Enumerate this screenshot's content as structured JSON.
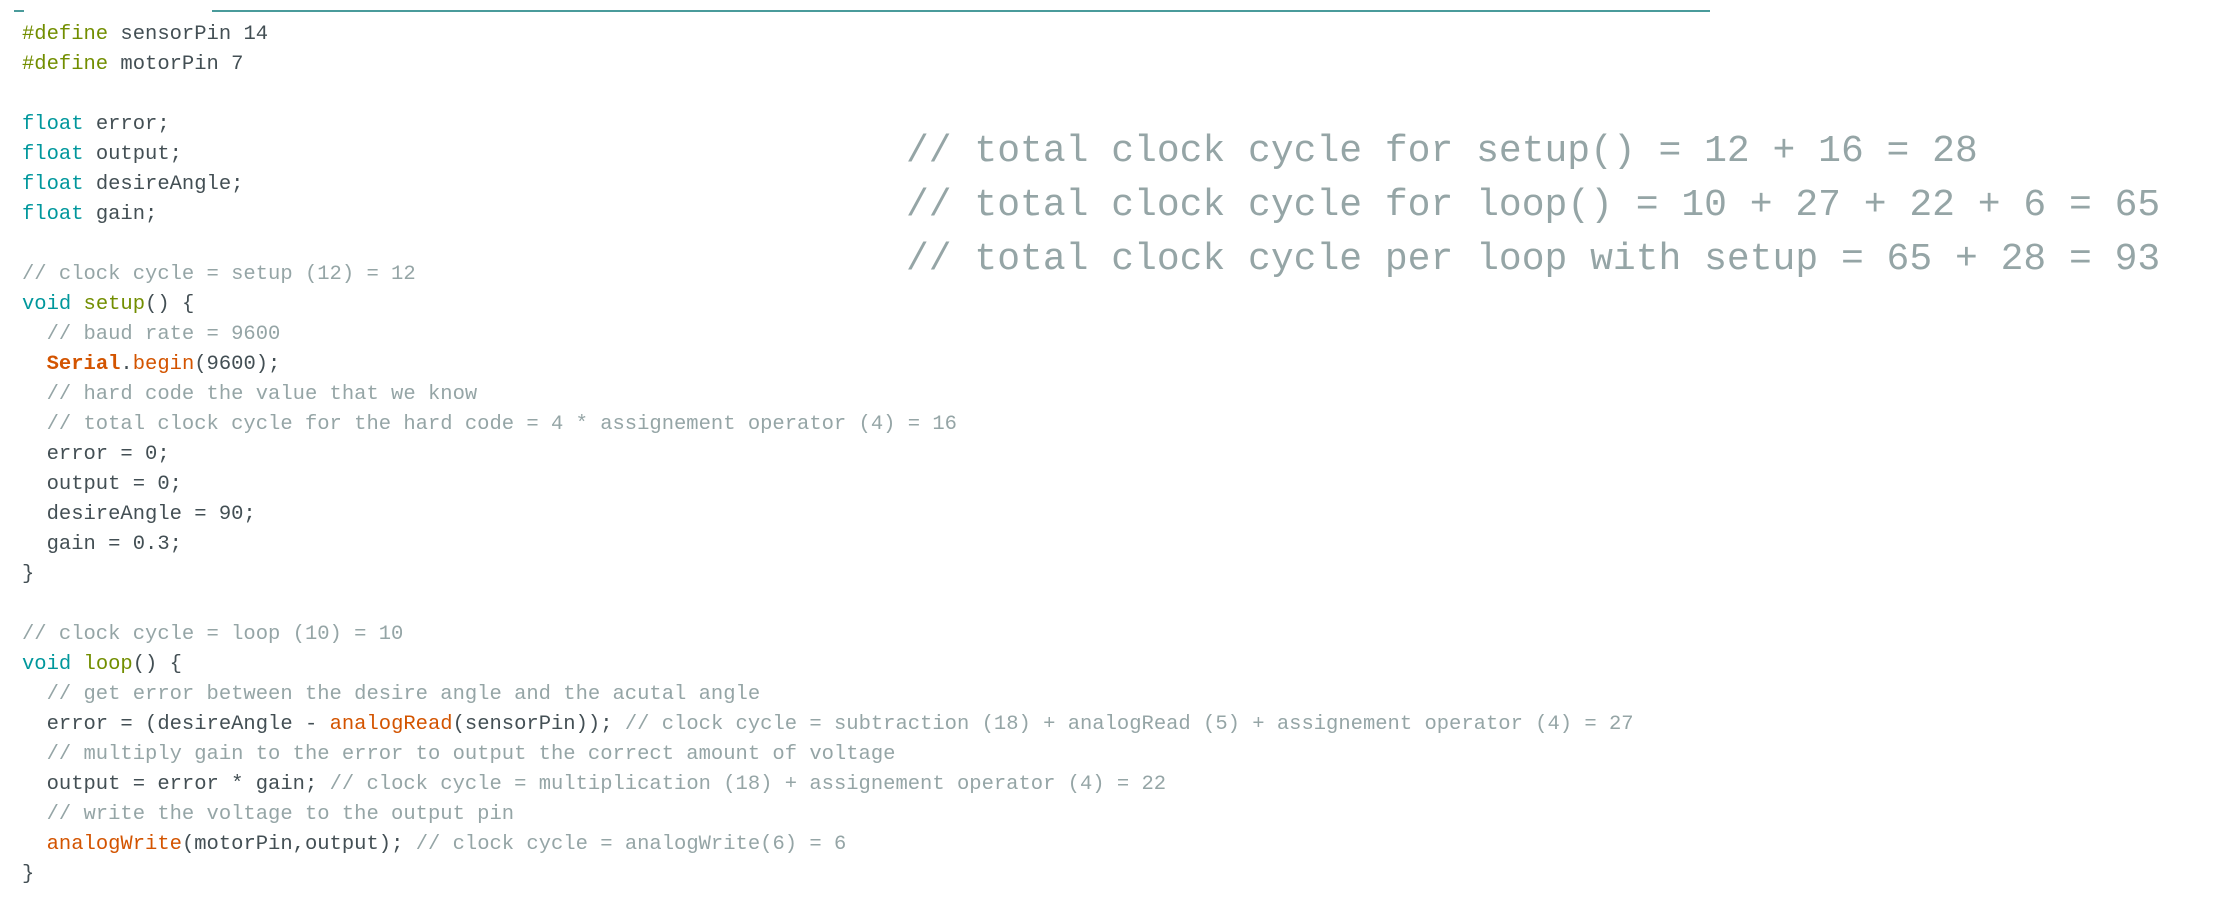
{
  "editor": {
    "lines": [
      [
        {
          "t": "#define",
          "c": "preproc"
        },
        {
          "t": " sensorPin 14",
          "c": "plain"
        }
      ],
      [
        {
          "t": "#define",
          "c": "preproc"
        },
        {
          "t": " motorPin 7",
          "c": "plain"
        }
      ],
      [],
      [
        {
          "t": "float",
          "c": "type"
        },
        {
          "t": " error;",
          "c": "plain"
        }
      ],
      [
        {
          "t": "float",
          "c": "type"
        },
        {
          "t": " output;",
          "c": "plain"
        }
      ],
      [
        {
          "t": "float",
          "c": "type"
        },
        {
          "t": " desireAngle;",
          "c": "plain"
        }
      ],
      [
        {
          "t": "float",
          "c": "type"
        },
        {
          "t": " gain;",
          "c": "plain"
        }
      ],
      [],
      [
        {
          "t": "// clock cycle = setup (12) = 12",
          "c": "comment"
        }
      ],
      [
        {
          "t": "void",
          "c": "type"
        },
        {
          "t": " ",
          "c": "plain"
        },
        {
          "t": "setup",
          "c": "preproc"
        },
        {
          "t": "() {",
          "c": "plain"
        }
      ],
      [
        {
          "t": "  // baud rate = 9600",
          "c": "comment"
        }
      ],
      [
        {
          "t": "  ",
          "c": "plain"
        },
        {
          "t": "Serial",
          "c": "class"
        },
        {
          "t": ".",
          "c": "plain"
        },
        {
          "t": "begin",
          "c": "func"
        },
        {
          "t": "(9600);",
          "c": "plain"
        }
      ],
      [
        {
          "t": "  // hard code the value that we know",
          "c": "comment"
        }
      ],
      [
        {
          "t": "  // total clock cycle for the hard code = 4 * assignement operator (4) = 16",
          "c": "comment"
        }
      ],
      [
        {
          "t": "  error = 0;",
          "c": "plain"
        }
      ],
      [
        {
          "t": "  output = 0;",
          "c": "plain"
        }
      ],
      [
        {
          "t": "  desireAngle = 90;",
          "c": "plain"
        }
      ],
      [
        {
          "t": "  gain = 0.3;",
          "c": "plain"
        }
      ],
      [
        {
          "t": "}",
          "c": "plain"
        }
      ],
      [],
      [
        {
          "t": "// clock cycle = loop (10) = 10",
          "c": "comment"
        }
      ],
      [
        {
          "t": "void",
          "c": "type"
        },
        {
          "t": " ",
          "c": "plain"
        },
        {
          "t": "loop",
          "c": "preproc"
        },
        {
          "t": "() {",
          "c": "plain"
        }
      ],
      [
        {
          "t": "  // get error between the desire angle and the acutal angle",
          "c": "comment"
        }
      ],
      [
        {
          "t": "  error = (desireAngle - ",
          "c": "plain"
        },
        {
          "t": "analogRead",
          "c": "func"
        },
        {
          "t": "(sensorPin)); ",
          "c": "plain"
        },
        {
          "t": "// clock cycle = subtraction (18) + analogRead (5) + assignement operator (4) = 27",
          "c": "comment"
        }
      ],
      [
        {
          "t": "  // multiply gain to the error to output the correct amount of voltage",
          "c": "comment"
        }
      ],
      [
        {
          "t": "  output = error * gain; ",
          "c": "plain"
        },
        {
          "t": "// clock cycle = multiplication (18) + assignement operator (4) = 22",
          "c": "comment"
        }
      ],
      [
        {
          "t": "  // write the voltage to the output pin",
          "c": "comment"
        }
      ],
      [
        {
          "t": "  ",
          "c": "plain"
        },
        {
          "t": "analogWrite",
          "c": "func"
        },
        {
          "t": "(motorPin,output); ",
          "c": "plain"
        },
        {
          "t": "// clock cycle = analogWrite(6) = 6",
          "c": "comment"
        }
      ],
      [
        {
          "t": "}",
          "c": "plain"
        }
      ]
    ]
  },
  "totals": [
    "// total clock cycle for setup() = 12 + 16 = 28",
    "// total clock cycle for loop() = 10 + 27 + 22 + 6 = 65",
    "// total clock cycle per loop with setup = 65 + 28 = 93"
  ]
}
